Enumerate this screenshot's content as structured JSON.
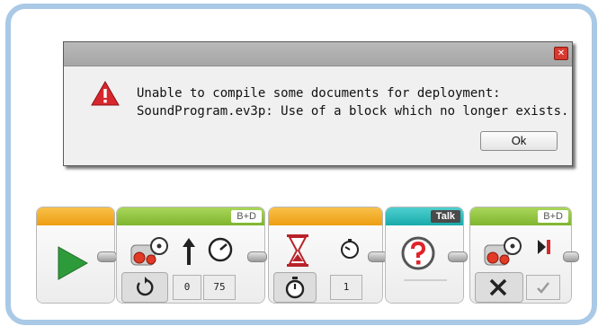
{
  "dialog": {
    "close_glyph": "✕",
    "message_line1": "Unable to compile some documents for deployment:",
    "message_line2": "SoundProgram.ev3p: Use of a block which no longer exists.",
    "ok_label": "Ok"
  },
  "blocks": [
    {
      "type": "start",
      "color": "#f3a71a"
    },
    {
      "type": "move-steering",
      "color": "#8bbf3a",
      "port": "B+D",
      "inputs": [
        "0",
        "75"
      ]
    },
    {
      "type": "wait-timer",
      "color": "#f3a71a",
      "inputs": [
        "1"
      ]
    },
    {
      "type": "missing-block",
      "color": "#1db5b5",
      "label": "Talk"
    },
    {
      "type": "move-steering-off",
      "color": "#8bbf3a",
      "port": "B+D"
    }
  ],
  "icons": [
    "warning-icon",
    "play-icon",
    "steering-icon",
    "arrow-up-icon",
    "speed-gauge-icon",
    "rotate-icon",
    "hourglass-icon",
    "timer-icon",
    "stopwatch-icon",
    "question-icon",
    "stop-x-icon",
    "checkmark-icon",
    "brake-icon"
  ]
}
